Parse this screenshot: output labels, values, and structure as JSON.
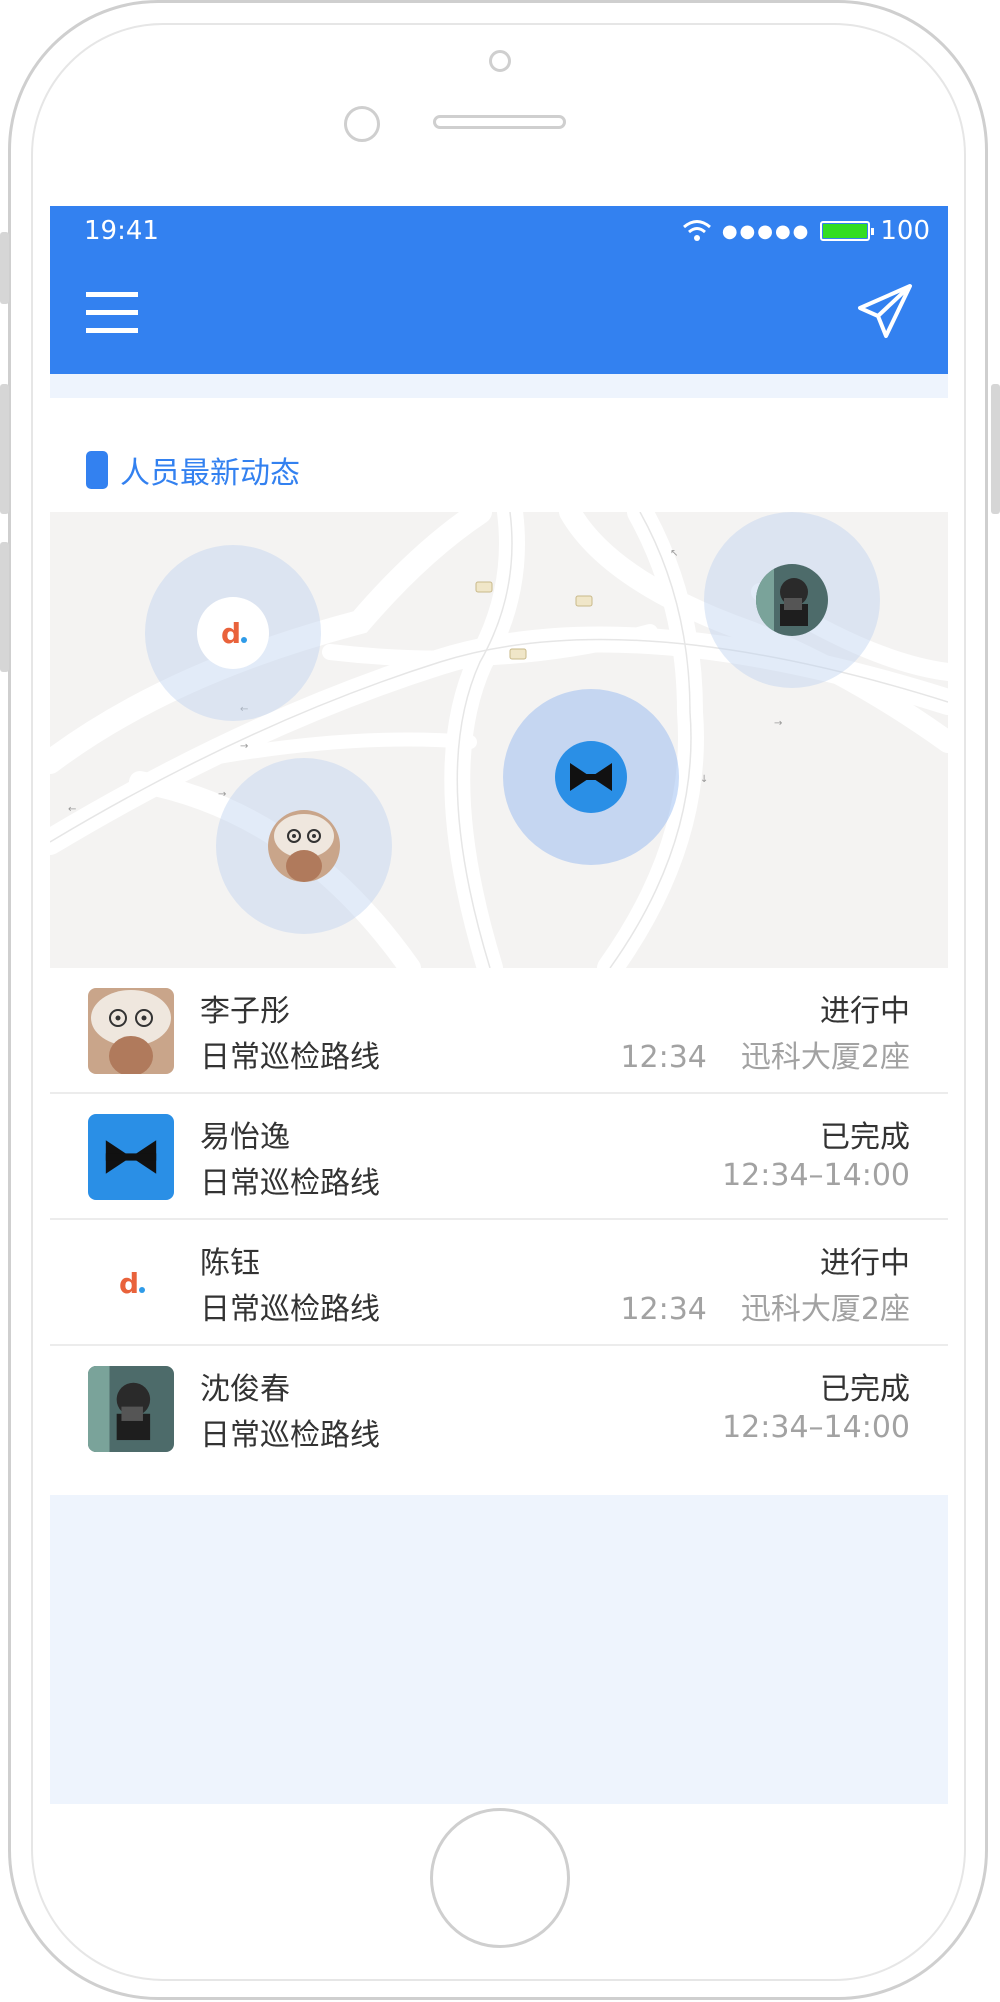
{
  "status_bar": {
    "time": "19:41",
    "signal": "●●●●●",
    "battery": "100"
  },
  "section": {
    "title": "人员最新动态"
  },
  "map": {
    "markers": [
      {
        "name": "陈钰",
        "icon": "d-logo-icon"
      },
      {
        "name": "沈俊春",
        "icon": "photo-avatar-icon"
      },
      {
        "name": "易怡逸",
        "icon": "bowtie-logo-icon"
      },
      {
        "name": "李子彤",
        "icon": "alpaca-hat-avatar-icon"
      }
    ]
  },
  "list": {
    "items": [
      {
        "name": "李子彤",
        "route": "日常巡检路线",
        "status": "进行中",
        "time": "12:34",
        "location": "迅科大厦2座",
        "avatar": "alpaca-hat-avatar-icon"
      },
      {
        "name": "易怡逸",
        "route": "日常巡检路线",
        "status": "已完成",
        "time": "12:34–14:00",
        "location": "",
        "avatar": "bowtie-logo-icon"
      },
      {
        "name": "陈钰",
        "route": "日常巡检路线",
        "status": "进行中",
        "time": "12:34",
        "location": "迅科大厦2座",
        "avatar": "d-logo-icon"
      },
      {
        "name": "沈俊春",
        "route": "日常巡检路线",
        "status": "已完成",
        "time": "12:34–14:00",
        "location": "",
        "avatar": "photo-avatar-icon"
      }
    ]
  },
  "colors": {
    "primary": "#3381f0",
    "page_bg": "#eef4fd",
    "battery": "#33dd22"
  }
}
